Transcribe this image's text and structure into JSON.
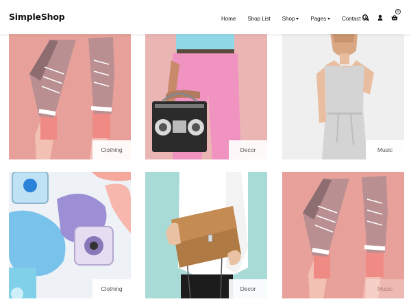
{
  "header": {
    "logo": "SimpleShop",
    "nav": [
      {
        "label": "Home",
        "dropdown": false
      },
      {
        "label": "Shop List",
        "dropdown": false
      },
      {
        "label": "Shop",
        "dropdown": true
      },
      {
        "label": "Pages",
        "dropdown": true
      },
      {
        "label": "Contact Us",
        "dropdown": false
      }
    ],
    "icons": [
      "search-icon",
      "user-icon",
      "cart-icon"
    ],
    "cart_count": "0"
  },
  "grid": {
    "tiles": [
      {
        "category": "Clothing",
        "image": "pink-sneakers"
      },
      {
        "category": "Decor",
        "image": "boombox-pink-pants"
      },
      {
        "category": "Music",
        "image": "woman-white-dress"
      },
      {
        "category": "Clothing",
        "image": "nail-polish"
      },
      {
        "category": "Decor",
        "image": "brown-leather-bag"
      },
      {
        "category": "Music",
        "image": "pink-sneakers"
      }
    ]
  }
}
